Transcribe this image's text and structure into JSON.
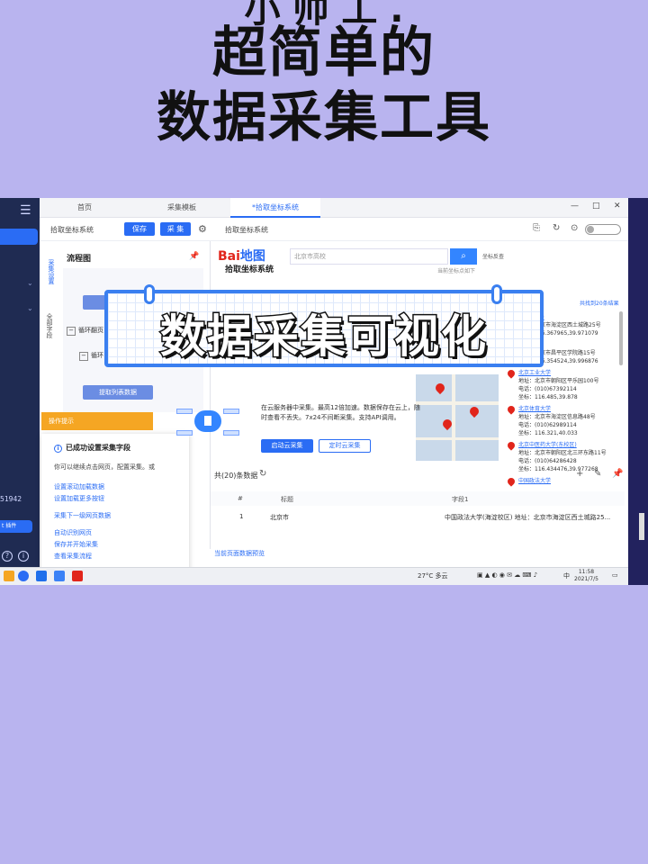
{
  "headline": {
    "top_partial": "小 帅 工 .",
    "line1": "超简单的",
    "line2": "数据采集工具"
  },
  "banner": {
    "text": "数据采集可视化"
  },
  "sidebar": {
    "id_text": "51942",
    "pill_text": "t 插件"
  },
  "tabs": [
    {
      "label": "首页"
    },
    {
      "label": "采集模板"
    },
    {
      "label": "*拾取坐标系统"
    }
  ],
  "toolbar": {
    "title": "拾取坐标系统",
    "save_label": "保存",
    "collect_label": "采 集",
    "url": "拾取坐标系统"
  },
  "flowchart": {
    "title": "流程图",
    "vtab_1": "采集设置",
    "vtab_2": "全部字段",
    "loop_1": "循环翻页",
    "loop_2": "循环",
    "extract_node": "提取列表数据",
    "op_tip": "操作提示"
  },
  "tips": {
    "heading": "已成功设置采集字段",
    "body": "你可以继续点击网页，配置采集。或",
    "links": [
      "设置滚动加载数据",
      "设置加载更多按钮"
    ],
    "link_next": "采集下一级网页数据",
    "links2": [
      "自动识别网页",
      "保存并开始采集",
      "查看采集流程"
    ]
  },
  "baidu": {
    "logo_bai": "Bai",
    "logo_du": "地图",
    "pick_title": "拾取坐标系统",
    "search_placeholder": "北京市高校",
    "coord_check": "坐标反查",
    "hint": "当前坐标点如下",
    "grid_link": "共找到20条结果"
  },
  "results": [
    {
      "name": "(海淀校区)",
      "addr": "地址：北京市海淀区西土城路25号",
      "coord": "坐标：116.367965,39.971079"
    },
    {
      "name": "(北京)",
      "addr": "地址：北京市昌平区学院路15号",
      "coord": "坐标：116.354524,39.996876"
    },
    {
      "name": "北京工业大学",
      "addr": "地址：北京市朝阳区平乐园100号",
      "tel": "电话：(010)67392114",
      "coord": "坐标：116.485,39.878"
    },
    {
      "name": "北京体育大学",
      "addr": "地址：北京市海淀区信息路48号",
      "tel": "电话：(010)62989114",
      "coord": "坐标：116.321,40.033"
    },
    {
      "name": "北京中医药大学(东校区)",
      "addr": "地址：北京市朝阳区北三环东路11号",
      "tel": "电话：(010)64286428",
      "coord": "坐标：116.434476,39.977268"
    },
    {
      "name": "中国政法大学",
      "addr": "",
      "coord": ""
    }
  ],
  "promo": {
    "text": "在云服务器中采集。最高12倍加速。数据保存在云上，随时查看不丢失。7x24不间断采集。支持API调用。",
    "btn_cloud": "启动云采集",
    "btn_timer": "定时云采集"
  },
  "table": {
    "count": "共(20)条数据",
    "headers": [
      "#",
      "标题",
      "字段1"
    ],
    "rows": [
      [
        "1",
        "北京市",
        "中国政法大学(海淀校区)  地址：北京市海淀区西土城路25..."
      ]
    ],
    "page_link": "当前页面数据预览"
  },
  "taskbar": {
    "weather": "27°C 多云",
    "ime": "中",
    "time": "11:58",
    "date": "2021/7/5"
  },
  "colors": {
    "background": "#b9b4ef",
    "accent": "#2a6cf4",
    "baidu_red": "#e1251b",
    "banner_border": "#3a7ff0"
  }
}
